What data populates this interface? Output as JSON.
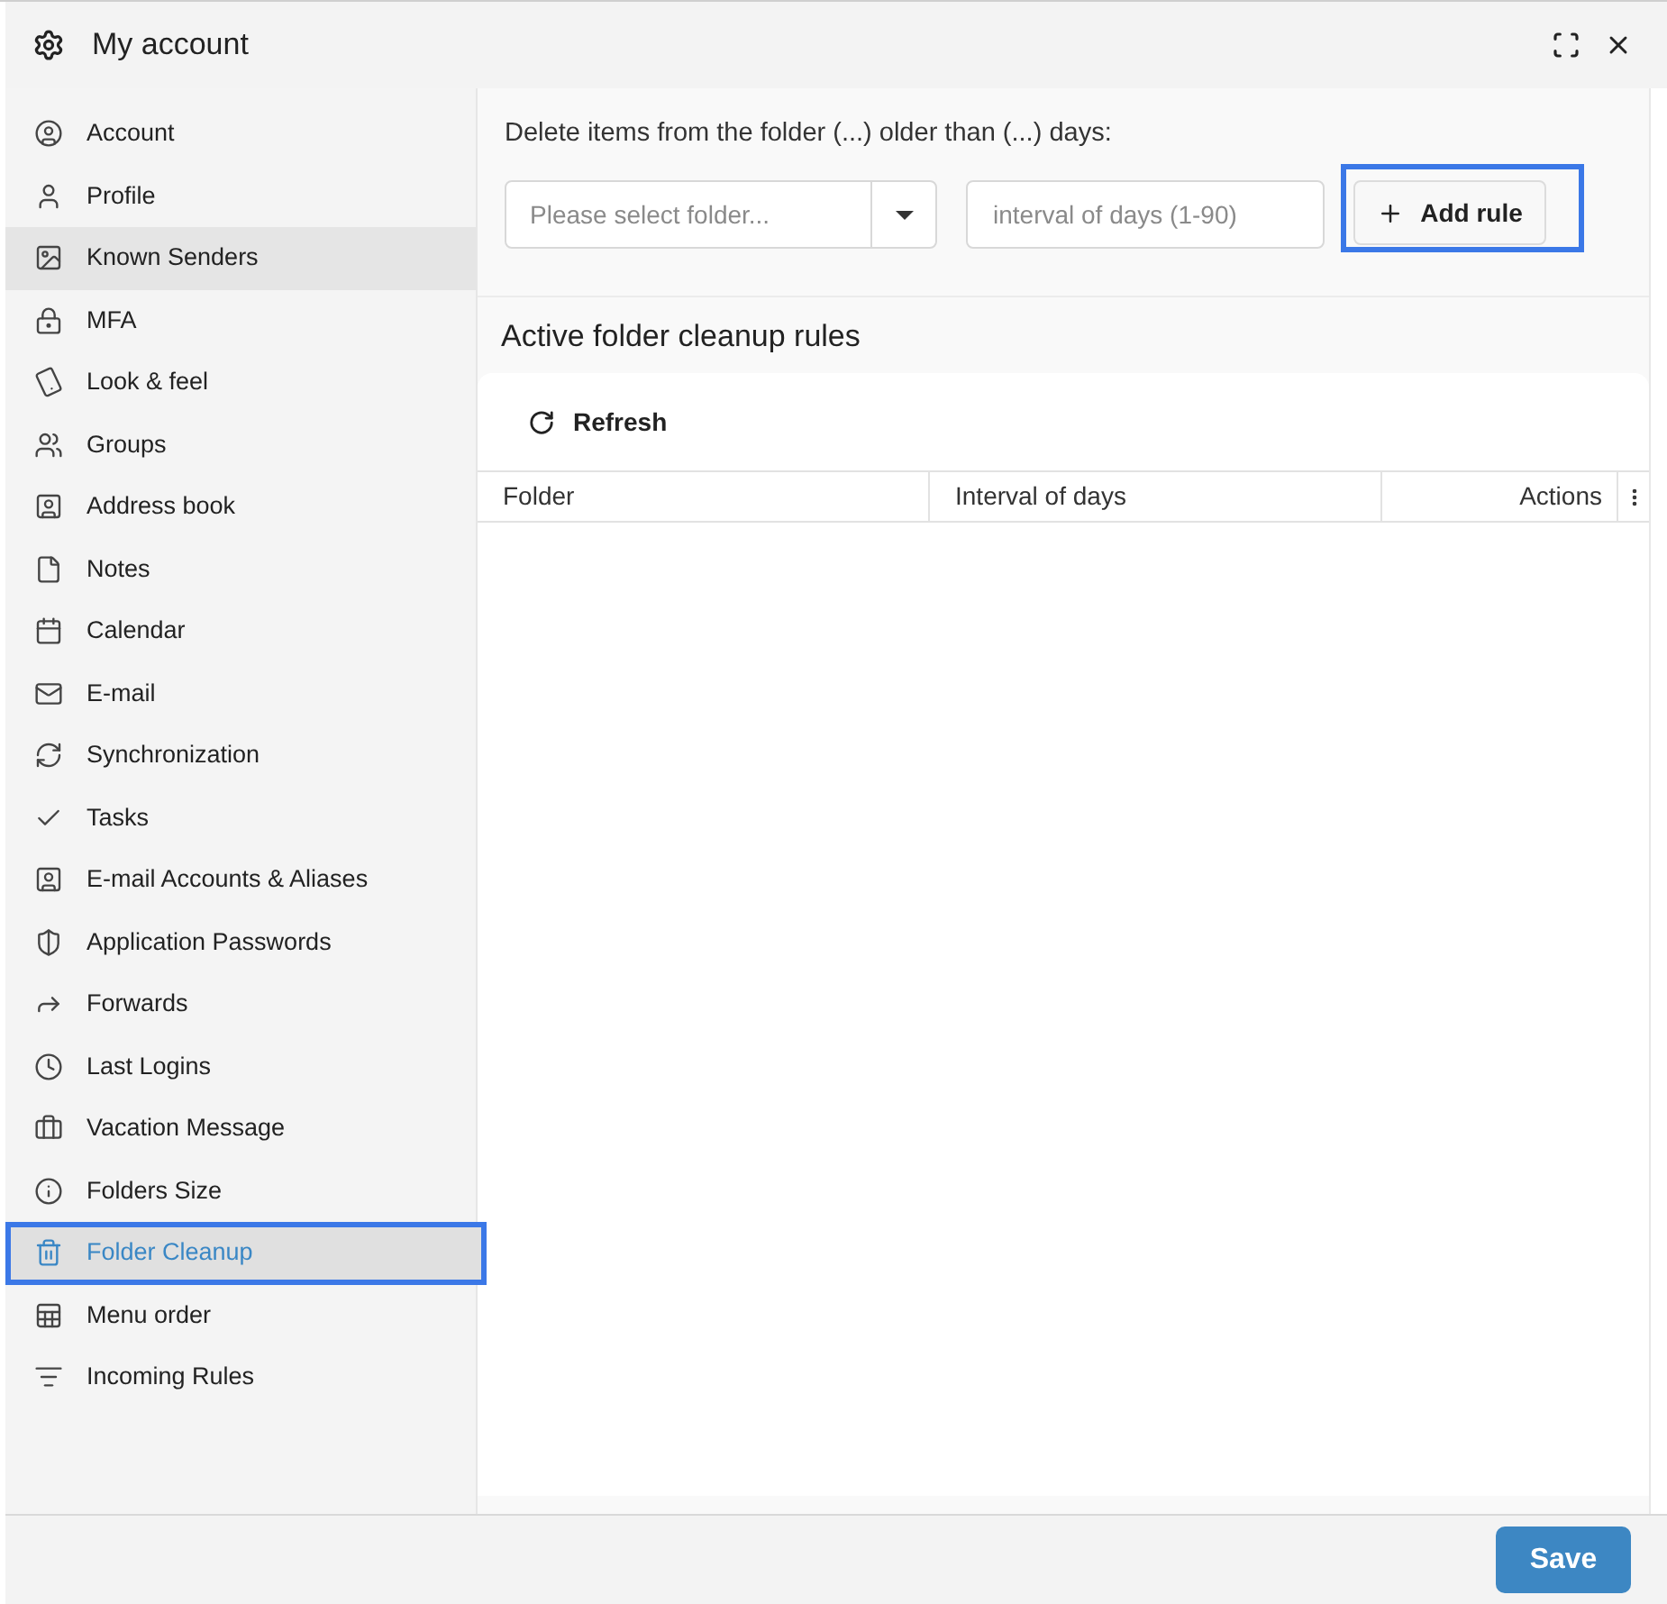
{
  "window": {
    "title": "My account"
  },
  "sidebar": {
    "items": [
      {
        "label": "Account",
        "selected": false,
        "hovered": false,
        "outlined": false
      },
      {
        "label": "Profile",
        "selected": false,
        "hovered": false,
        "outlined": false
      },
      {
        "label": "Known Senders",
        "selected": false,
        "hovered": true,
        "outlined": false
      },
      {
        "label": "MFA",
        "selected": false,
        "hovered": false,
        "outlined": false
      },
      {
        "label": "Look & feel",
        "selected": false,
        "hovered": false,
        "outlined": false
      },
      {
        "label": "Groups",
        "selected": false,
        "hovered": false,
        "outlined": false
      },
      {
        "label": "Address book",
        "selected": false,
        "hovered": false,
        "outlined": false
      },
      {
        "label": "Notes",
        "selected": false,
        "hovered": false,
        "outlined": false
      },
      {
        "label": "Calendar",
        "selected": false,
        "hovered": false,
        "outlined": false
      },
      {
        "label": "E-mail",
        "selected": false,
        "hovered": false,
        "outlined": false
      },
      {
        "label": "Synchronization",
        "selected": false,
        "hovered": false,
        "outlined": false
      },
      {
        "label": "Tasks",
        "selected": false,
        "hovered": false,
        "outlined": false
      },
      {
        "label": "E-mail Accounts & Aliases",
        "selected": false,
        "hovered": false,
        "outlined": false
      },
      {
        "label": "Application Passwords",
        "selected": false,
        "hovered": false,
        "outlined": false
      },
      {
        "label": "Forwards",
        "selected": false,
        "hovered": false,
        "outlined": false
      },
      {
        "label": "Last Logins",
        "selected": false,
        "hovered": false,
        "outlined": false
      },
      {
        "label": "Vacation Message",
        "selected": false,
        "hovered": false,
        "outlined": false
      },
      {
        "label": "Folders Size",
        "selected": false,
        "hovered": false,
        "outlined": false
      },
      {
        "label": "Folder Cleanup",
        "selected": true,
        "hovered": false,
        "outlined": true
      },
      {
        "label": "Menu order",
        "selected": false,
        "hovered": false,
        "outlined": false
      },
      {
        "label": "Incoming Rules",
        "selected": false,
        "hovered": false,
        "outlined": false
      }
    ]
  },
  "form": {
    "label": "Delete items from the folder (...) older than (...) days:",
    "folder_select": {
      "placeholder": "Please select folder..."
    },
    "days_input": {
      "placeholder": "interval of days (1-90)"
    },
    "add_button": {
      "label": "Add rule",
      "outlined": true
    }
  },
  "rules": {
    "title": "Active folder cleanup rules",
    "refresh_button": {
      "label": "Refresh"
    },
    "table": {
      "columns": [
        "Folder",
        "Interval of days",
        "Actions"
      ]
    }
  },
  "footer": {
    "save_button": {
      "label": "Save"
    }
  }
}
